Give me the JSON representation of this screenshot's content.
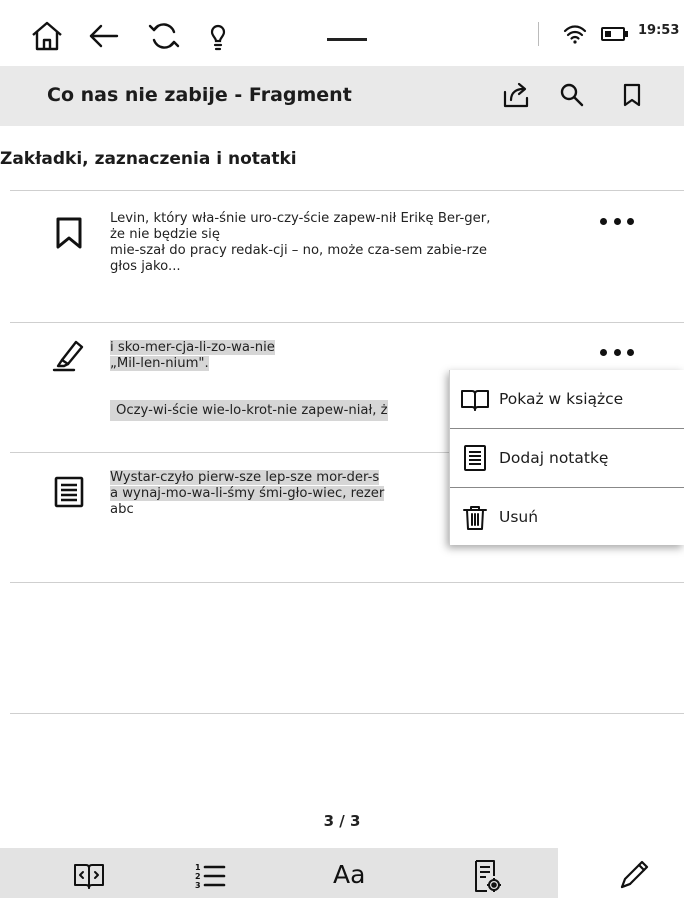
{
  "status_bar": {
    "icons": [
      "home-icon",
      "back-icon",
      "refresh-icon",
      "lightbulb-icon",
      "wifi-icon",
      "battery-icon"
    ],
    "time": "19:53"
  },
  "title_bar": {
    "title": "Co nas nie zabije - Fragment",
    "icons": [
      "share-icon",
      "search-icon",
      "bookmark-icon"
    ]
  },
  "section": {
    "title": "Zakładki, zaznaczenia i notatki"
  },
  "items": [
    {
      "type": "bookmark",
      "icon": "bookmark-icon",
      "lines": [
        "Levin, który wła-śnie uro-czy-ście zapew-nił Erikę Ber-ger,",
        "że nie będzie się",
        "mie-szał do pracy redak-cji – no, może cza-sem zabie-rze",
        "głos jako..."
      ]
    },
    {
      "type": "highlight",
      "icon": "highlighter-icon",
      "lines": [
        "i sko-mer-cja-li-zo-wa-nie",
        "„Mil-len-nium\"."
      ],
      "extra_line": "Oczy-wi-ście wie-lo-krot-nie zapew-niał, ż"
    },
    {
      "type": "note",
      "icon": "note-icon",
      "lines": [
        "Wystar-czyło pierw-sze lep-sze mor-der-s",
        "a wynaj-mo-wa-li-śmy śmi-gło-wiec, rezer"
      ],
      "note": "abc"
    }
  ],
  "context_menu": {
    "items": [
      {
        "label": "Pokaż w książce",
        "icon": "open-book-icon"
      },
      {
        "label": "Dodaj notatkę",
        "icon": "note-icon"
      },
      {
        "label": "Usuń",
        "icon": "trash-icon"
      }
    ]
  },
  "pagination": {
    "label": "3 / 3"
  },
  "bottom_bar": {
    "font_label": "Aa",
    "icons": [
      "book-navigation-icon",
      "contents-list-icon",
      "font-settings-icon",
      "document-settings-icon",
      "pencil-icon"
    ]
  }
}
